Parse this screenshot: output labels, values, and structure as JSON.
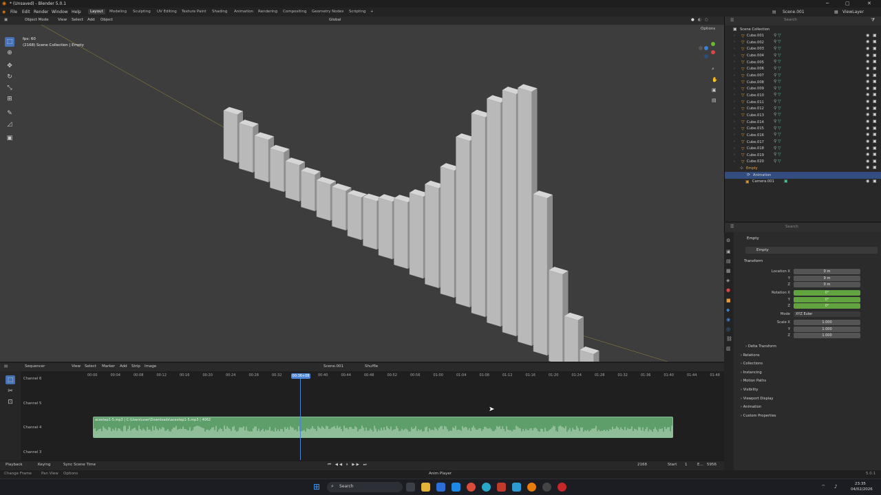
{
  "window": {
    "title": "* (Unsaved) - Blender 5.0.1"
  },
  "menus": [
    "File",
    "Edit",
    "Render",
    "Window",
    "Help"
  ],
  "workspaces": [
    "Layout",
    "Modeling",
    "Sculpting",
    "UV Editing",
    "Texture Paint",
    "Shading",
    "Animation",
    "Rendering",
    "Compositing",
    "Geometry Nodes",
    "Scripting"
  ],
  "workspace_add": "+",
  "topright": {
    "scene": "Scene.001",
    "view_layer": "ViewLayer"
  },
  "viewport": {
    "mode": "Object Mode",
    "menu": [
      "View",
      "Select",
      "Add",
      "Object"
    ],
    "transform_orientation": "Global",
    "options": "Options",
    "overlay_fps": "fps: 60",
    "overlay_info": "(2168) Scene Collection | Empty"
  },
  "outliner": {
    "search_placeholder": "Search",
    "root": "Scene Collection",
    "items": [
      "Cube.001",
      "Cube.002",
      "Cube.003",
      "Cube.004",
      "Cube.005",
      "Cube.006",
      "Cube.007",
      "Cube.008",
      "Cube.009",
      "Cube.010",
      "Cube.011",
      "Cube.012",
      "Cube.013",
      "Cube.014",
      "Cube.015",
      "Cube.016",
      "Cube.017",
      "Cube.018",
      "Cube.019",
      "Cube.020"
    ],
    "empty": "Empty",
    "animation": "Animation",
    "camera": "Camera.001"
  },
  "properties": {
    "search_placeholder": "Search",
    "object": "Empty",
    "object_name": "Empty",
    "section_transform": "Transform",
    "location": {
      "label": "Location X",
      "y": "Y",
      "z": "Z",
      "values": [
        "0 m",
        "9 m",
        "0 m"
      ]
    },
    "rotation": {
      "label": "Rotation X",
      "y": "Y",
      "z": "Z",
      "values": [
        "0°",
        "0°",
        "0°"
      ]
    },
    "mode_label": "Mode",
    "mode_value": "XYZ Euler",
    "scale": {
      "label": "Scale X",
      "y": "Y",
      "z": "Z",
      "values": [
        "1.000",
        "1.000",
        "1.000"
      ]
    },
    "sections": [
      "Delta Transform",
      "Relations",
      "Collections",
      "Instancing",
      "Motion Paths",
      "Visibility",
      "Viewport Display",
      "Animation",
      "Custom Properties"
    ]
  },
  "sequencer": {
    "editor": "Sequencer",
    "menu": [
      "View",
      "Select",
      "Marker",
      "Add",
      "Strip",
      "Image"
    ],
    "scene": "Scene.001",
    "shuffle": "Shuffle",
    "channels": [
      "Channel 6",
      "Channel 5",
      "Channel 4",
      "Channel 3"
    ],
    "ticks": [
      "00:00",
      "00:04",
      "00:08",
      "00:12",
      "00:16",
      "00:20",
      "00:24",
      "00:28",
      "00:32",
      "00:36+08",
      "00:40",
      "00:44",
      "00:48",
      "00:52",
      "00:56",
      "01:00",
      "01:04",
      "01:08",
      "01:12",
      "01:16",
      "01:20",
      "01:24",
      "01:28",
      "01:32",
      "01:36",
      "01:40",
      "01:44",
      "01:48"
    ],
    "current_time": "00:36+08",
    "strip_label": "acestep1-5.mp3 | C:\\Users\\user\\Downloads\\acestep1-5.mp3 | 4062"
  },
  "playback": {
    "playback": "Playback",
    "keying": "Keying",
    "sync": "Sync Scene Time",
    "frame": "2168",
    "start_label": "Start",
    "start": "1",
    "end_label": "E...",
    "end": "5956"
  },
  "statusbar": {
    "left": [
      "Change Frame",
      "Pan View",
      "Options"
    ],
    "center": "Anim Player",
    "version": "5.0.1"
  },
  "taskbar": {
    "search": "Search",
    "time": "23:35",
    "date": "04/02/2026"
  },
  "bar_heights": [
    0.16,
    0.15,
    0.14,
    0.13,
    0.12,
    0.12,
    0.12,
    0.13,
    0.14,
    0.16,
    0.19,
    0.22,
    0.27,
    0.33,
    0.42,
    0.55,
    0.66,
    0.74,
    0.8,
    0.84,
    0.52,
    0.3,
    0.18,
    0.1
  ]
}
